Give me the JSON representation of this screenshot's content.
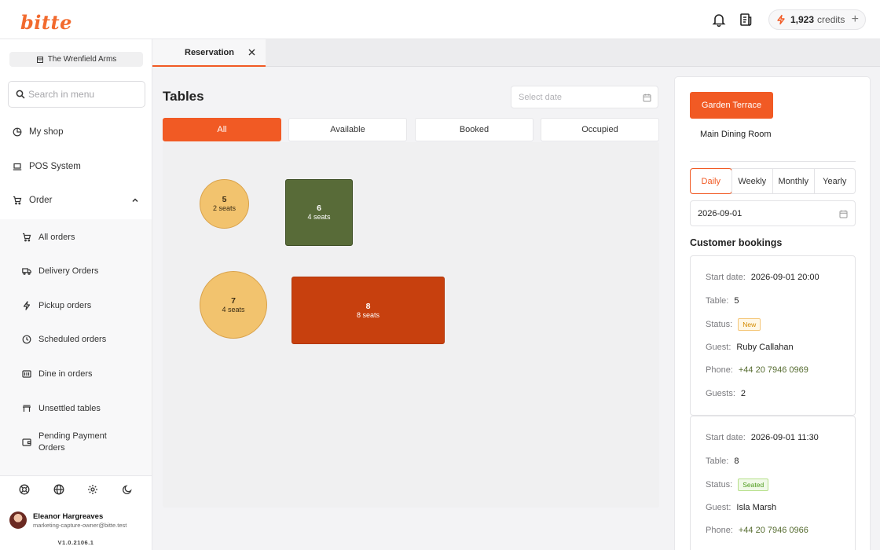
{
  "header": {
    "logo": "bitte",
    "credits_amount": "1,923",
    "credits_label": "credits",
    "credits_add": "+"
  },
  "sidebar": {
    "shop_name": "The Wrenfield Arms",
    "search_placeholder": "Search in menu",
    "items": [
      {
        "label": "My shop"
      },
      {
        "label": "POS System"
      },
      {
        "label": "Order"
      }
    ],
    "order_subitems": [
      {
        "label": "All orders"
      },
      {
        "label": "Delivery Orders"
      },
      {
        "label": "Pickup orders"
      },
      {
        "label": "Scheduled orders"
      },
      {
        "label": "Dine in orders"
      },
      {
        "label": "Unsettled tables"
      },
      {
        "label": "Pending Payment Orders"
      }
    ],
    "user": {
      "name": "Eleanor Hargreaves",
      "email": "marketing-capture-owner@bitte.test"
    },
    "version": "V1.0.2106.1"
  },
  "tabs": [
    {
      "label": "Reservation"
    }
  ],
  "main": {
    "title": "Tables",
    "date_placeholder": "Select date",
    "filters": [
      {
        "label": "All",
        "active": true
      },
      {
        "label": "Available",
        "active": false
      },
      {
        "label": "Booked",
        "active": false
      },
      {
        "label": "Occupied",
        "active": false
      }
    ],
    "tables": [
      {
        "number": "5",
        "seats": "2 seats",
        "shape": "round",
        "status": "booked"
      },
      {
        "number": "6",
        "seats": "4 seats",
        "shape": "rect",
        "status": "occupied"
      },
      {
        "number": "7",
        "seats": "4 seats",
        "shape": "round",
        "status": "booked"
      },
      {
        "number": "8",
        "seats": "8 seats",
        "shape": "rect",
        "status": "seated"
      }
    ]
  },
  "right_panel": {
    "rooms": [
      "Garden Terrace",
      "Main Dining Room"
    ],
    "periods": [
      {
        "label": "Daily",
        "active": true
      },
      {
        "label": "Weekly",
        "active": false
      },
      {
        "label": "Monthly",
        "active": false
      },
      {
        "label": "Yearly",
        "active": false
      }
    ],
    "date": "2026-09-01",
    "section_title": "Customer bookings",
    "labels": {
      "start": "Start date:",
      "table": "Table:",
      "status": "Status:",
      "guest": "Guest:",
      "phone": "Phone:",
      "guests": "Guests:"
    },
    "bookings": [
      {
        "start": "2026-09-01 20:00",
        "table": "5",
        "status": "New",
        "guest": "Ruby Callahan",
        "phone": "+44 20 7946 0969",
        "guests": "2"
      },
      {
        "start": "2026-09-01 11:30",
        "table": "8",
        "status": "Seated",
        "guest": "Isla Marsh",
        "phone": "+44 20 7946 0966",
        "guests": ""
      }
    ]
  },
  "colors": {
    "accent": "#f15a24",
    "table_round": "#f2c36e",
    "table_green": "#586b38",
    "table_red": "#c7400e"
  }
}
